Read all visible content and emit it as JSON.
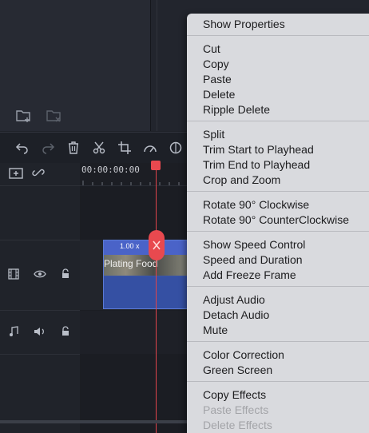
{
  "context_menu": {
    "groups": [
      [
        {
          "label": "Show Properties",
          "enabled": true
        }
      ],
      [
        {
          "label": "Cut",
          "enabled": true
        },
        {
          "label": "Copy",
          "enabled": true
        },
        {
          "label": "Paste",
          "enabled": true
        },
        {
          "label": "Delete",
          "enabled": true
        },
        {
          "label": "Ripple Delete",
          "enabled": true
        }
      ],
      [
        {
          "label": "Split",
          "enabled": true
        },
        {
          "label": "Trim Start to Playhead",
          "enabled": true
        },
        {
          "label": "Trim End to Playhead",
          "enabled": true
        },
        {
          "label": "Crop and Zoom",
          "enabled": true
        }
      ],
      [
        {
          "label": "Rotate 90° Clockwise",
          "enabled": true
        },
        {
          "label": "Rotate 90° CounterClockwise",
          "enabled": true
        }
      ],
      [
        {
          "label": "Show Speed Control",
          "enabled": true
        },
        {
          "label": "Speed and Duration",
          "enabled": true
        },
        {
          "label": "Add Freeze Frame",
          "enabled": true
        }
      ],
      [
        {
          "label": "Adjust Audio",
          "enabled": true
        },
        {
          "label": "Detach Audio",
          "enabled": true
        },
        {
          "label": "Mute",
          "enabled": true
        }
      ],
      [
        {
          "label": "Color Correction",
          "enabled": true
        },
        {
          "label": "Green Screen",
          "enabled": true
        }
      ],
      [
        {
          "label": "Copy Effects",
          "enabled": true
        },
        {
          "label": "Paste Effects",
          "enabled": false
        },
        {
          "label": "Delete Effects",
          "enabled": false
        }
      ]
    ]
  },
  "timeline": {
    "timecode": "00:00:00:00",
    "clip": {
      "speed": "1.00 x",
      "title": "Plating Food"
    }
  },
  "icons": {
    "media": [
      "new-folder-icon",
      "delete-folder-icon"
    ],
    "toolbar": [
      "undo-icon",
      "redo-icon",
      "trash-icon",
      "scissors-icon",
      "crop-icon",
      "speed-icon",
      "color-icon"
    ],
    "timeline": [
      "add-track-icon",
      "link-icon"
    ],
    "video_track": [
      "film-icon",
      "eye-icon",
      "lock-icon"
    ],
    "audio_track": [
      "music-note-icon",
      "speaker-icon",
      "lock-icon"
    ]
  },
  "colors": {
    "accent_playhead": "#e8494f",
    "clip_blue": "#3a55a6",
    "menu_bg": "#d9dade"
  }
}
